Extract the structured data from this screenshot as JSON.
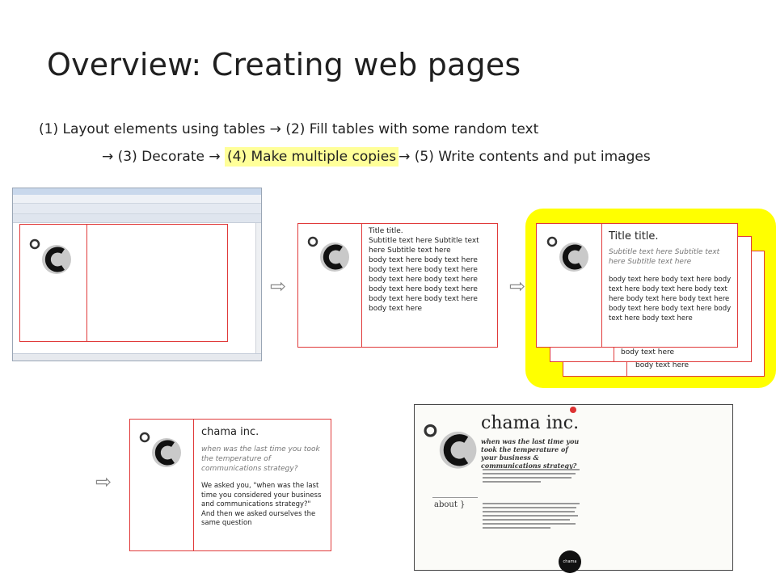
{
  "title": "Overview: Creating web pages",
  "flow": {
    "line1": "(1) Layout elements using tables → (2) Fill tables with some random text",
    "line2_a": "→ (3) Decorate → ",
    "line2_highlight": "(4) Make multiple copies",
    "line2_b": "→ (5) Write contents and put images"
  },
  "panel2": {
    "title": "Title title.",
    "subtitle": "Subtitle text here Subtitle text here Subtitle text here",
    "body": "body text here body text here body text here body text here body text here body text here body text here body text here body text here body text here body text here"
  },
  "panel3": {
    "title": "Title title.",
    "subtitle": "Subtitle text here Subtitle text here Subtitle text here",
    "body": "body text here body text here body text here body text here body text here body text here body text here body text here body text here body text here body text here",
    "back1": "body text here",
    "back2": "body text here"
  },
  "panel4": {
    "title": "chama inc.",
    "subtitle": "when was the last time you took the temperature of communications strategy?",
    "body": "We asked you, \"when was the last time you considered your business and communications strategy?\" And then we asked ourselves the same question"
  },
  "site": {
    "title": "chama inc.",
    "tagline": "when was the last time you took the temperature of your business & communications strategy?",
    "nav": "about }",
    "badge": "chama"
  },
  "colors": {
    "highlight": "#ffff99",
    "yellow": "#ffff00",
    "table_border": "#e03a3a"
  }
}
